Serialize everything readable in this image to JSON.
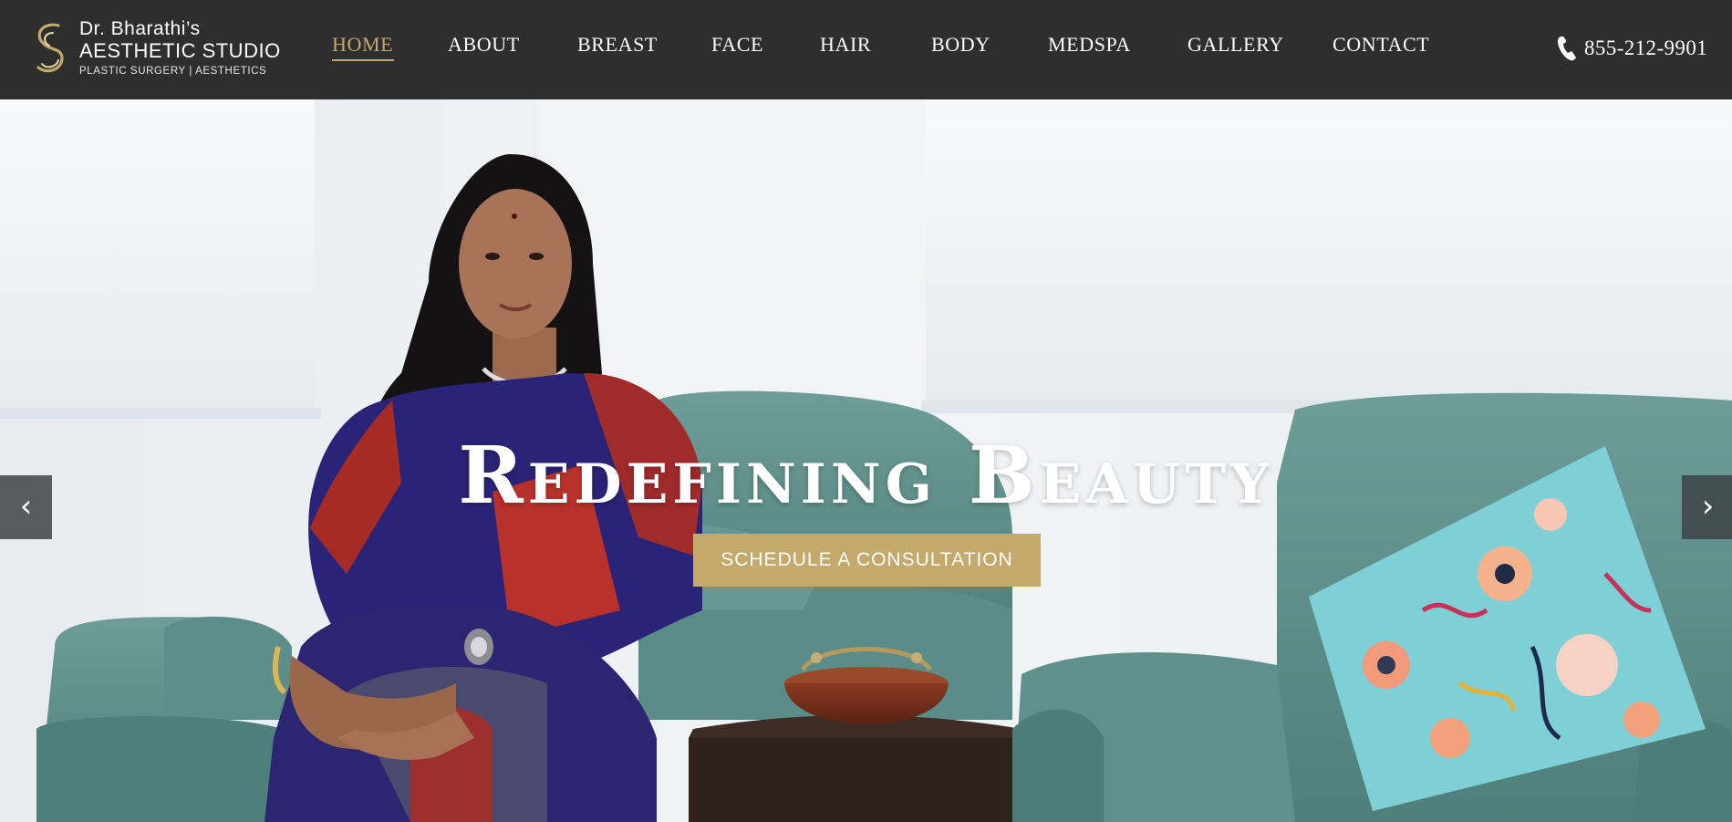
{
  "brand": {
    "line1": "Dr. Bharathi’s",
    "line2": "AESTHETIC STUDIO",
    "line3": "PLASTIC SURGERY | AESTHETICS",
    "accent_color": "#c3a96c",
    "header_bg": "#2e2e2e"
  },
  "nav": {
    "items": [
      {
        "label": "HOME",
        "active": true
      },
      {
        "label": "ABOUT",
        "active": false
      },
      {
        "label": "BREAST",
        "active": false
      },
      {
        "label": "FACE",
        "active": false
      },
      {
        "label": "HAIR",
        "active": false
      },
      {
        "label": "BODY",
        "active": false
      },
      {
        "label": "MEDSPA",
        "active": false
      },
      {
        "label": "GALLERY",
        "active": false
      },
      {
        "label": "CONTACT",
        "active": false
      }
    ]
  },
  "phone": {
    "icon": "phone-icon",
    "number": "855-212-9901"
  },
  "hero": {
    "headline": "Redefining Beauty",
    "cta_label": "SCHEDULE A CONSULTATION",
    "prev_arrow": "‹",
    "next_arrow": "›",
    "cta_color": "#c3a96c",
    "sofa_color": "#5f918c"
  }
}
